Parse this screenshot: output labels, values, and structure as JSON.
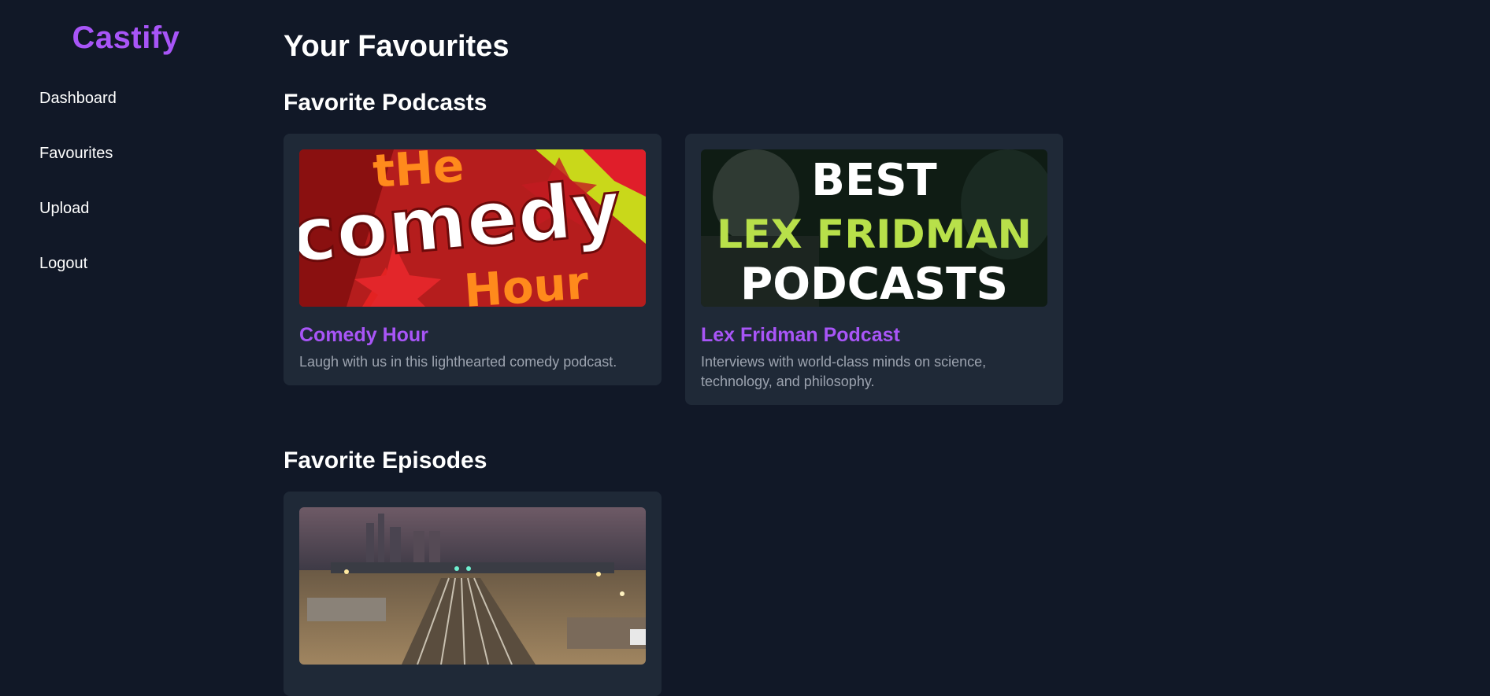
{
  "app": {
    "logo": "Castify"
  },
  "sidebar": {
    "items": [
      {
        "label": "Dashboard"
      },
      {
        "label": "Favourites"
      },
      {
        "label": "Upload"
      },
      {
        "label": "Logout"
      }
    ]
  },
  "main": {
    "title": "Your Favourites",
    "podcasts_section": {
      "title": "Favorite Podcasts",
      "cards": [
        {
          "title": "Comedy Hour",
          "description": "Laugh with us in this lighthearted comedy podcast.",
          "thumb_lines": [
            "tHe",
            "comedy",
            "Hour"
          ]
        },
        {
          "title": "Lex Fridman Podcast",
          "description": "Interviews with world-class minds on science, technology, and philosophy.",
          "thumb_lines": [
            "BEST",
            "LEX FRIDMAN",
            "PODCASTS"
          ]
        }
      ]
    },
    "episodes_section": {
      "title": "Favorite Episodes"
    }
  },
  "colors": {
    "background": "#111827",
    "card": "#1f2937",
    "accent": "#a855f7",
    "muted_text": "#9ca3af"
  }
}
